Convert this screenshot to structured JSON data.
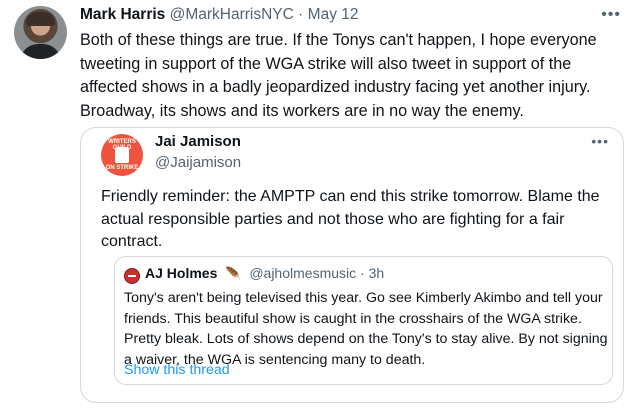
{
  "tweet": {
    "author_name": "Mark Harris",
    "handle": "@MarkHarrisNYC",
    "separator": "·",
    "date": "May 12",
    "more_icon": "more-horizontal-icon",
    "text": "Both of these things are true. If the Tonys can't happen, I hope everyone tweeting in support of the WGA strike will also tweet in support of the affected shows in a badly jeopardized industry facing yet another injury. Broadway, its shows and its workers are in no way the enemy."
  },
  "quote": {
    "author_name": "Jai Jamison",
    "handle": "@Jaijamison",
    "more_icon": "more-horizontal-icon",
    "avatar_text_top": "WRITERS GUILD",
    "avatar_text_bottom": "ON STRIKE",
    "text": "Friendly reminder: the AMPTP can end this strike tomorrow.  Blame the actual responsible parties and not those who are fighting for a fair contract."
  },
  "nested_quote": {
    "author_name": "AJ Holmes",
    "emoji": "🪶",
    "handle": "@ajholmesmusic",
    "separator": "·",
    "time": "3h",
    "text": "Tony's aren't being televised this year. Go see Kimberly Akimbo and tell your friends. This beautiful show is caught in the crosshairs of the WGA strike. Pretty bleak. Lots of shows depend on the Tony's to stay alive. By not signing a waiver, the WGA is sentencing many to death.",
    "show_thread_label": "Show this thread"
  },
  "colors": {
    "text_primary": "#0f1419",
    "text_secondary": "#536471",
    "link": "#1d9bf0",
    "border": "#cfd9de"
  }
}
